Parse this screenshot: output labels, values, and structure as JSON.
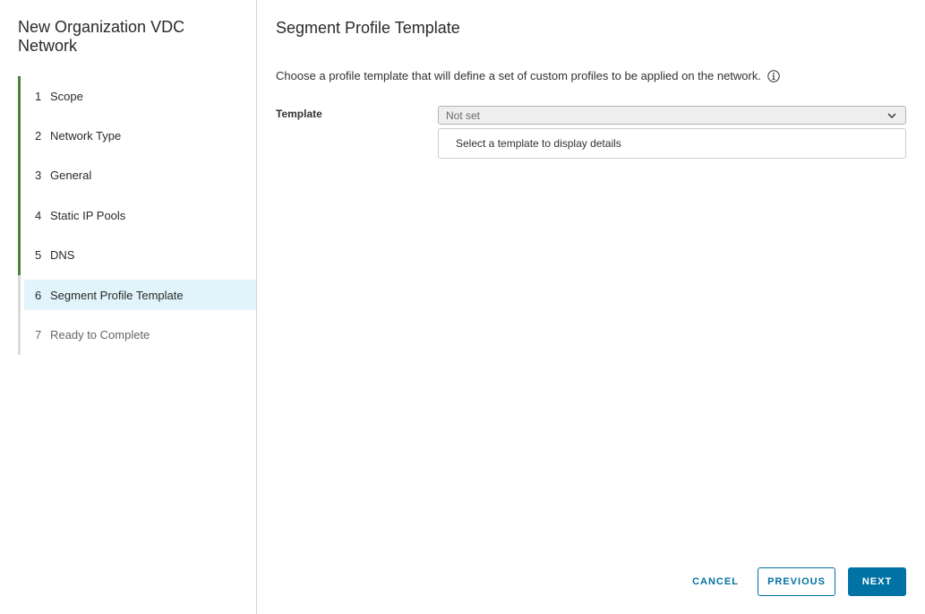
{
  "wizard": {
    "title": "New Organization VDC Network"
  },
  "steps": [
    {
      "num": "1",
      "label": "Scope",
      "state": "completed"
    },
    {
      "num": "2",
      "label": "Network Type",
      "state": "completed"
    },
    {
      "num": "3",
      "label": "General",
      "state": "completed"
    },
    {
      "num": "4",
      "label": "Static IP Pools",
      "state": "completed"
    },
    {
      "num": "5",
      "label": "DNS",
      "state": "completed"
    },
    {
      "num": "6",
      "label": "Segment Profile Template",
      "state": "active"
    },
    {
      "num": "7",
      "label": "Ready to Complete",
      "state": "future"
    }
  ],
  "main": {
    "title": "Segment Profile Template",
    "description": "Choose a profile template that will define a set of custom profiles to be applied on the network.",
    "info_icon": "info-circle-icon",
    "template_label": "Template",
    "template_value": "Not set",
    "details_placeholder": "Select a template to display details"
  },
  "footer": {
    "cancel_label": "CANCEL",
    "previous_label": "PREVIOUS",
    "next_label": "NEXT"
  },
  "colors": {
    "accent": "#0072a3",
    "completed_step": "#48823a",
    "active_step_bg": "#e1f3fb"
  }
}
